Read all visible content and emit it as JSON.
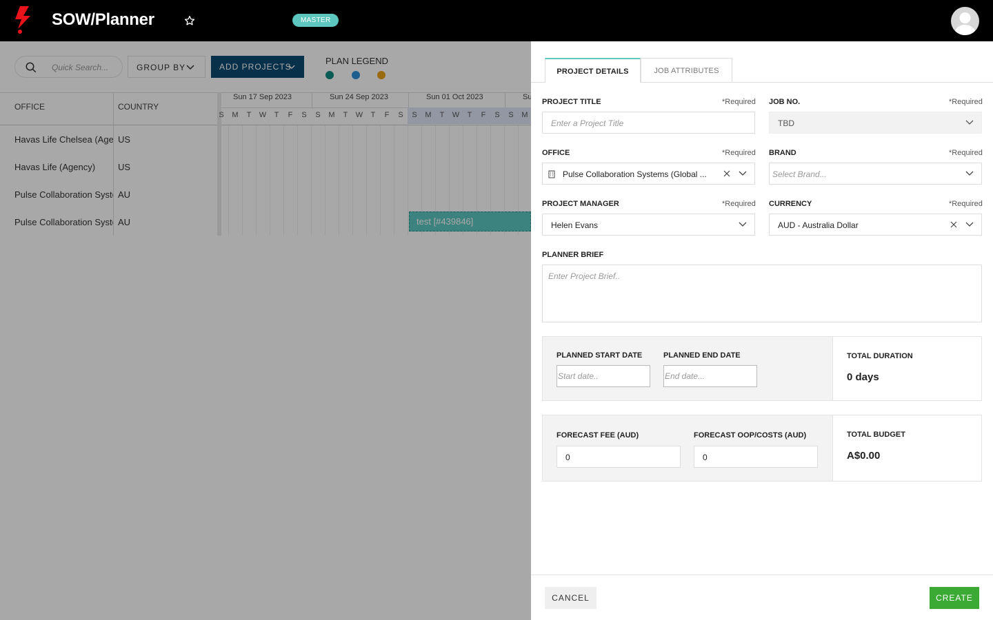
{
  "header": {
    "app_title": "SOW/Planner",
    "badge": "MASTER",
    "brand_color": "#e8131b"
  },
  "toolbar": {
    "search_placeholder": "Quick Search...",
    "group_by_label": "GROUP BY",
    "add_projects_label": "ADD PROJECTS",
    "legend_title": "PLAN LEGEND",
    "legend_colors": [
      "#0f8a7e",
      "#2e8fd8",
      "#e8a217"
    ]
  },
  "grid": {
    "columns": [
      "OFFICE",
      "COUNTRY"
    ],
    "weeks": [
      "Sun 17 Sep 2023",
      "Sun 24 Sep 2023",
      "Sun 01 Oct 2023",
      "Su"
    ],
    "days": [
      "S",
      "M",
      "T",
      "W",
      "T",
      "F",
      "S",
      "S",
      "M",
      "T",
      "W",
      "T",
      "F",
      "S",
      "S",
      "M",
      "T",
      "W",
      "T",
      "F",
      "S",
      "S",
      "M"
    ],
    "rows": [
      {
        "office": "Havas Life Chelsea (Agen",
        "country": "US"
      },
      {
        "office": "Havas Life (Agency)",
        "country": "US"
      },
      {
        "office": "Pulse Collaboration Syste",
        "country": "AU"
      },
      {
        "office": "Pulse Collaboration Syste",
        "country": "AU"
      }
    ],
    "bar_label": "test [#439846]"
  },
  "drawer": {
    "tabs": [
      "PROJECT DETAILS",
      "JOB ATTRIBUTES"
    ],
    "required_text": "*Required",
    "project_title": {
      "label": "PROJECT TITLE",
      "placeholder": "Enter a Project Title"
    },
    "job_no": {
      "label": "JOB NO.",
      "value": "TBD"
    },
    "office": {
      "label": "OFFICE",
      "value": "Pulse Collaboration Systems (Global ..."
    },
    "brand": {
      "label": "BRAND",
      "placeholder": "Select Brand..."
    },
    "project_manager": {
      "label": "PROJECT MANAGER",
      "value": "Helen Evans"
    },
    "currency": {
      "label": "CURRENCY",
      "value": "AUD - Australia Dollar"
    },
    "planner_brief": {
      "label": "PLANNER BRIEF",
      "placeholder": "Enter Project Brief.."
    },
    "dates": {
      "start_label": "PLANNED START DATE",
      "start_placeholder": "Start date..",
      "end_label": "PLANNED END DATE",
      "end_placeholder": "End date...",
      "duration_label": "TOTAL DURATION",
      "duration_value": "0 days"
    },
    "budget": {
      "fee_label": "FORECAST FEE (AUD)",
      "fee_value": "0",
      "oop_label": "FORECAST OOP/COSTS (AUD)",
      "oop_value": "0",
      "total_label": "TOTAL BUDGET",
      "total_value": "A$0.00"
    },
    "cancel_label": "CANCEL",
    "create_label": "CREATE"
  }
}
